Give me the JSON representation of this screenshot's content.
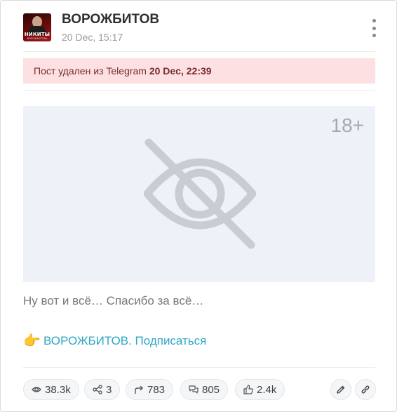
{
  "post": {
    "channel_name": "ВОРОЖБИТОВ",
    "date": "20 Dec, 15:17",
    "avatar_text": "НИКИТЫ",
    "avatar_subtext": "ВОРОЖБИТОВА",
    "menu_icon": "kebab-icon"
  },
  "alert": {
    "text": "Пост удален из Telegram ",
    "deleted_at": "20 Dec, 22:39",
    "color": "#fde0e1"
  },
  "media": {
    "age_label": "18+",
    "icon": "eye-slash-icon"
  },
  "body": {
    "text": "Ну вот и всё… Спасибо за всё…",
    "subscribe_emoji": "👉",
    "subscribe_link": "ВОРОЖБИТОВ. Подписаться",
    "link_color": "#2fa7c7"
  },
  "stats": {
    "views": "38.3k",
    "shares": "3",
    "forwards": "783",
    "comments": "805",
    "reactions": "2.4k"
  },
  "actions": {
    "edit_icon": "pencil-icon",
    "link_icon": "chain-link-icon"
  }
}
